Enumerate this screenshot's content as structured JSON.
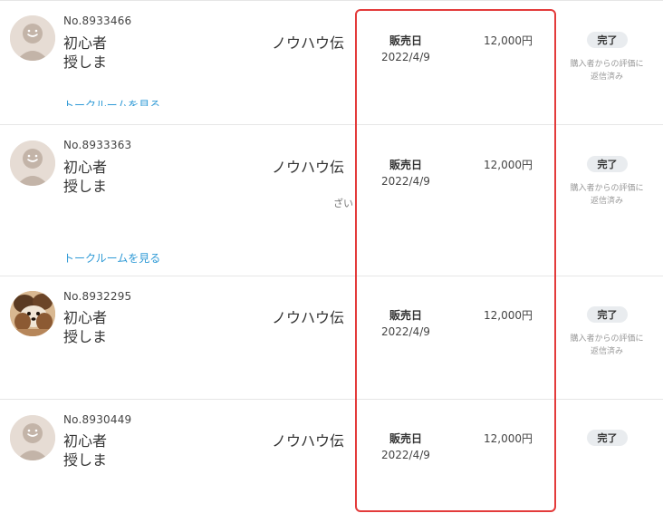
{
  "orders": [
    {
      "order_no": "No.8933466",
      "title_line1": "初心者",
      "title_line2": "授しま",
      "title_suffix": "ノウハウ伝",
      "sale_label": "販売日",
      "sale_date": "2022/4/9",
      "price": "12,000円",
      "status": "完了",
      "review_note": [
        "購入者からの評価に",
        "返信済み"
      ],
      "talk_link": "トークルームを見る",
      "avatar": "default-avatar"
    },
    {
      "order_no": "No.8933363",
      "title_line1": "初心者",
      "title_line2": "授しま",
      "title_suffix": "ノウハウ伝",
      "sale_label": "販売日",
      "sale_date": "2022/4/9",
      "price": "12,000円",
      "status": "完了",
      "review_note": [
        "購入者からの評価に",
        "返信済み"
      ],
      "talk_link": "トークルームを見る",
      "stray_text": "ざい",
      "avatar": "default-avatar"
    },
    {
      "order_no": "No.8932295",
      "title_line1": "初心者",
      "title_line2": "授しま",
      "title_suffix": "ノウハウ伝",
      "sale_label": "販売日",
      "sale_date": "2022/4/9",
      "price": "12,000円",
      "status": "完了",
      "review_note": [
        "購入者からの評価に",
        "返信済み"
      ],
      "avatar": "dog-photo-avatar"
    },
    {
      "order_no": "No.8930449",
      "title_line1": "初心者",
      "title_line2": "授しま",
      "title_suffix": "ノウハウ伝",
      "sale_label": "販売日",
      "sale_date": "2022/4/9",
      "price": "12,000円",
      "status": "完了",
      "avatar": "default-avatar"
    }
  ],
  "colors": {
    "link": "#2f9ad6",
    "highlight_border": "#e33b3b",
    "badge_bg": "#e9ecef",
    "avatar_bg": "#e6dcd4"
  }
}
